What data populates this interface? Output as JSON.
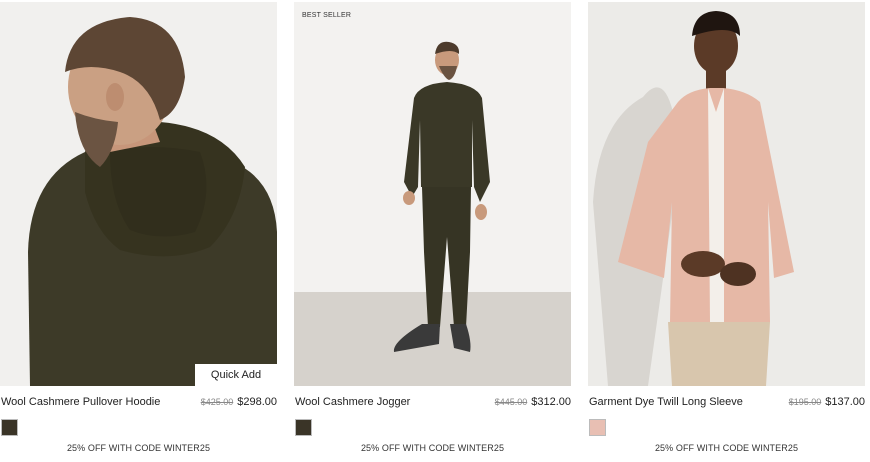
{
  "products": [
    {
      "name": "Wool Cashmere Pullover Hoodie",
      "original_price": "$425.00",
      "sale_price": "$298.00",
      "badge": "",
      "quick_add_label": "Quick Add",
      "swatch_color": "#3a3427",
      "promo": "25% OFF WITH CODE WINTER25"
    },
    {
      "name": "Wool Cashmere Jogger",
      "original_price": "$445.00",
      "sale_price": "$312.00",
      "badge": "BEST SELLER",
      "swatch_color": "#3a3427",
      "promo": "25% OFF WITH CODE WINTER25"
    },
    {
      "name": "Garment Dye Twill Long Sleeve",
      "original_price": "$195.00",
      "sale_price": "$137.00",
      "badge": "",
      "swatch_color": "#e8bfb3",
      "promo": "25% OFF WITH CODE WINTER25"
    }
  ]
}
